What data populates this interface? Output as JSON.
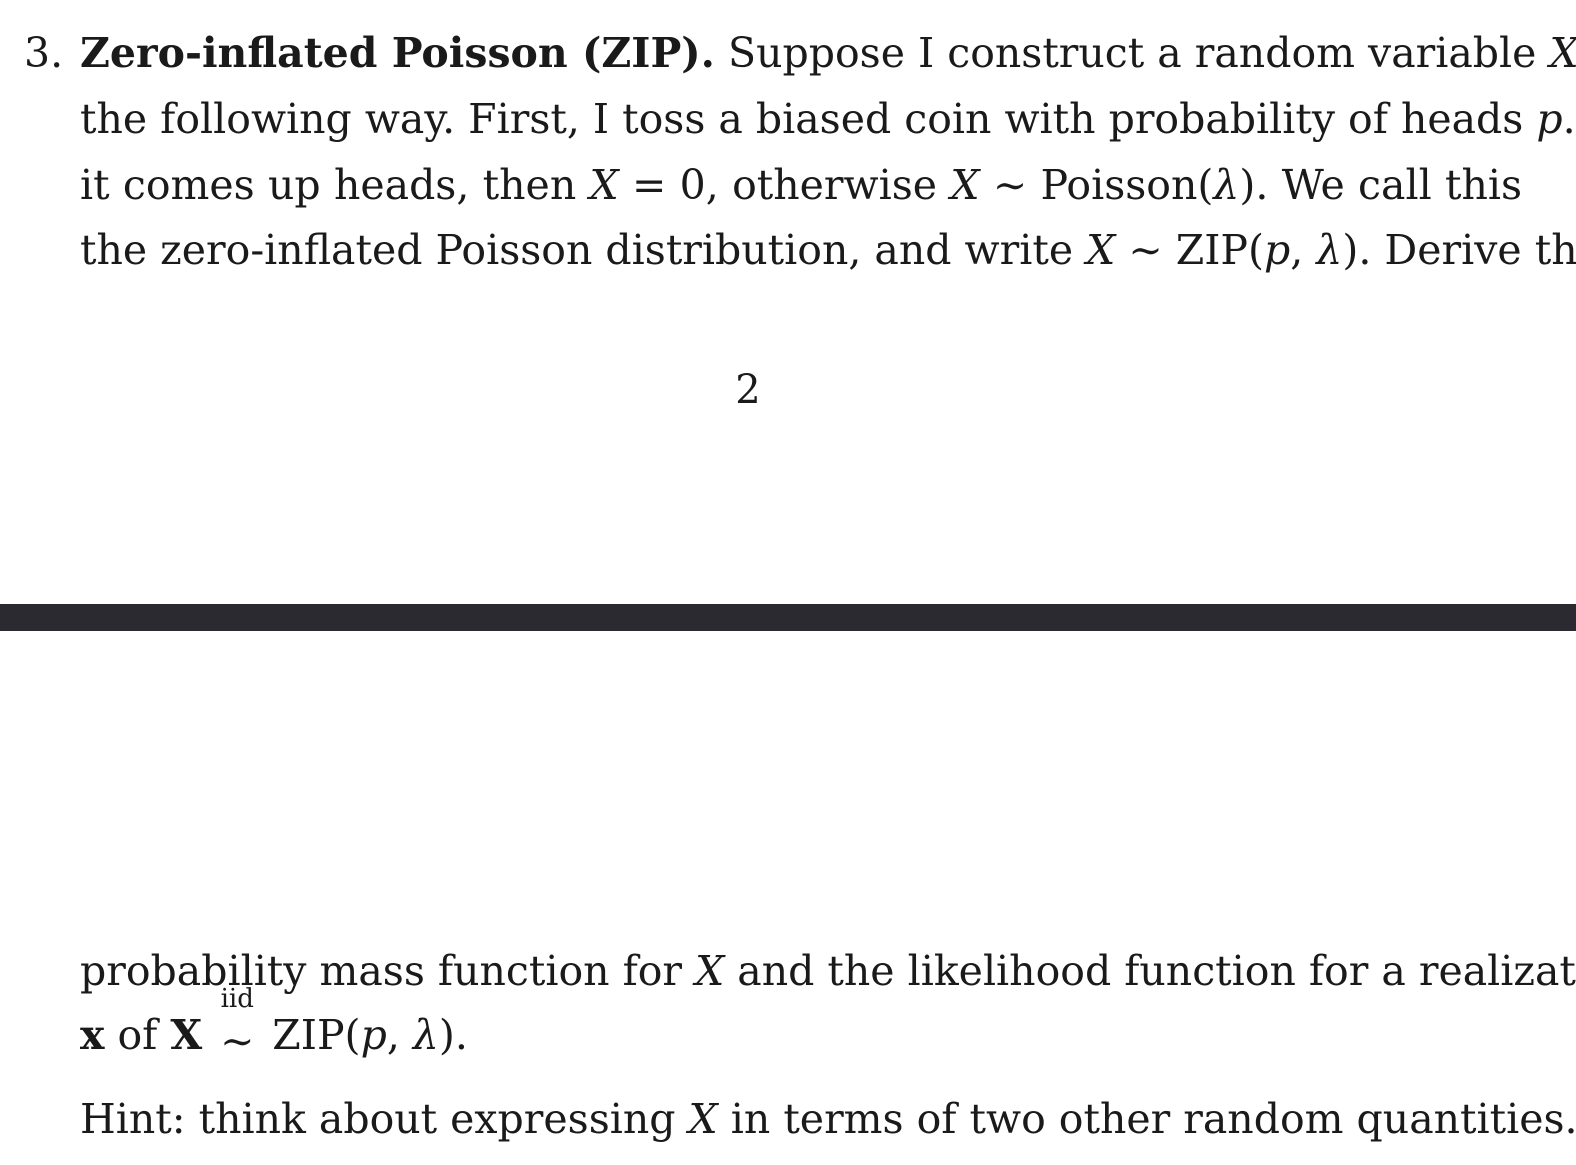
{
  "problem": {
    "number": "3.",
    "lines": [
      "Zero-inflated Poisson (ZIP). Suppose I construct a random variable X in",
      "the following way.  First, I toss a biased coin with probability of heads p.  If",
      "it comes up heads, then X = 0, otherwise X ~ Poisson(λ).  We call this",
      "the zero-inflated Poisson distribution, and write X ~ ZIP(p, λ).  Derive the",
      "probability mass function for X and the likelihood function for a realization",
      "x of X iid~ ZIP(p, λ)."
    ],
    "hint": "Hint: think about expressing X in terms of two other random quantities."
  },
  "page_number": "2"
}
